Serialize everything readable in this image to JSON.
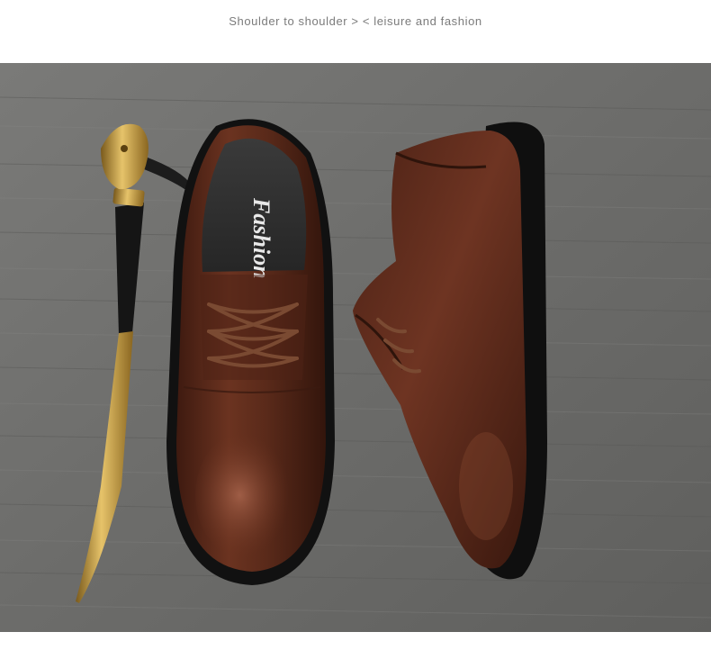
{
  "header": {
    "caption": "Shoulder to shoulder > < leisure and fashion"
  },
  "product_photo": {
    "insole_brand_text": "Fashion",
    "colors": {
      "floor": "#6d6d6b",
      "leather": "#5a2a1a",
      "sole": "#141414",
      "brass": "#c79a3a"
    }
  }
}
